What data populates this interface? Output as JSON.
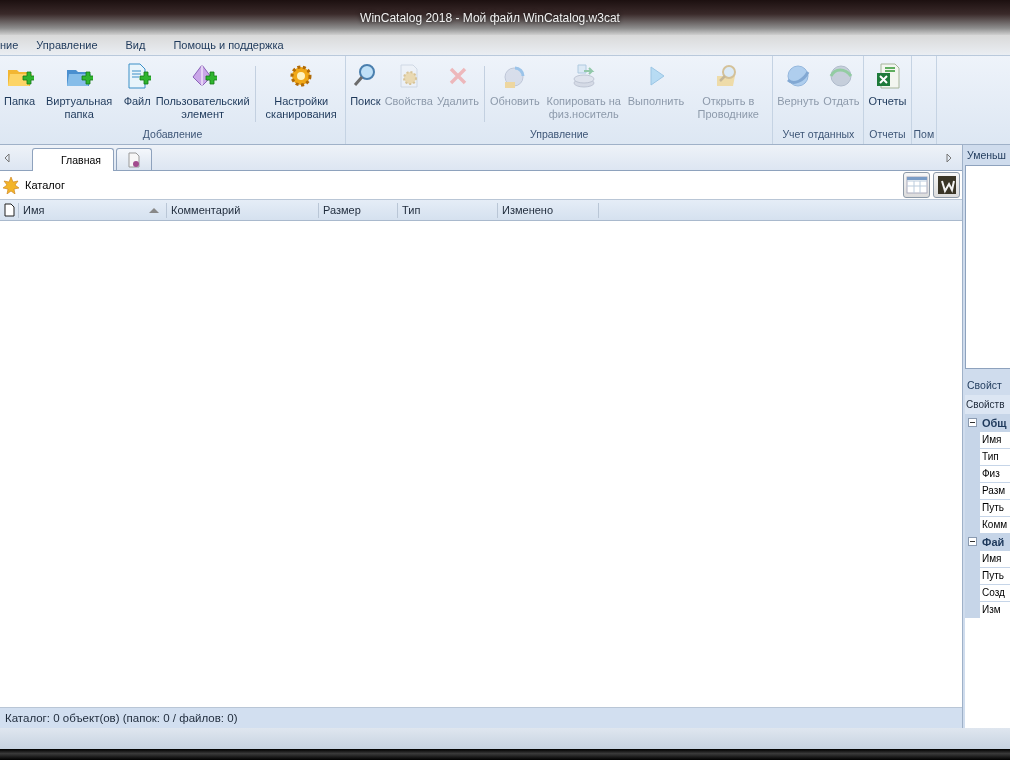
{
  "window": {
    "title": "WinCatalog 2018 - Мой файл WinCatalog.w3cat"
  },
  "menu": [
    "ние",
    "Управление",
    "Вид",
    "Помощь и поддержка"
  ],
  "ribbon": [
    {
      "label": "Добавление",
      "sections": [
        [
          {
            "label": "Папка",
            "disabled": false
          },
          {
            "label": "Виртуальная папка",
            "disabled": false
          },
          {
            "label": "Файл",
            "disabled": false
          },
          {
            "label": "Пользовательский элемент",
            "disabled": false
          }
        ],
        [
          {
            "label": "Настройки сканирования",
            "disabled": false
          }
        ]
      ]
    },
    {
      "label": "Управление",
      "sections": [
        [
          {
            "label": "Поиск",
            "disabled": false
          },
          {
            "label": "Свойства",
            "disabled": true
          },
          {
            "label": "Удалить",
            "disabled": true
          }
        ],
        [
          {
            "label": "Обновить",
            "disabled": true
          },
          {
            "label": "Копировать на физ.носитель",
            "disabled": true
          },
          {
            "label": "Выполнить",
            "disabled": true
          },
          {
            "label": "Открыть в Проводнике",
            "disabled": true
          }
        ]
      ]
    },
    {
      "label": "Учет отданных",
      "sections": [
        [
          {
            "label": "Вернуть",
            "disabled": true
          },
          {
            "label": "Отдать",
            "disabled": true
          }
        ]
      ]
    },
    {
      "label": "Отчеты",
      "sections": [
        [
          {
            "label": "Отчеты",
            "disabled": false
          }
        ]
      ]
    },
    {
      "label": "Пом"
    }
  ],
  "tabs": [
    {
      "label": "Главная",
      "selected": true
    },
    {
      "kind": "icon",
      "selected": false
    }
  ],
  "path": {
    "label": "Каталог"
  },
  "columns": [
    {
      "label": "Имя",
      "sorted": true
    },
    {
      "label": "Комментарий",
      "sorted": false
    },
    {
      "label": "Размер",
      "sorted": false
    },
    {
      "label": "Тип",
      "sorted": false
    },
    {
      "label": "Изменено",
      "sorted": false
    }
  ],
  "status_bar": "Каталог: 0 объект(ов) (папок: 0 / файлов: 0)",
  "preview_panel": {
    "title": "Уменьш"
  },
  "properties_panel": {
    "title": "Свойст",
    "subtitle": "Свойств",
    "groups": [
      {
        "label": "Общ",
        "expanded": true,
        "rows": [
          "Имя",
          "Тип",
          "Физ",
          "Разм",
          "Путь",
          "Комм"
        ]
      },
      {
        "label": "Фай",
        "expanded": true,
        "rows": [
          "Имя",
          "Путь",
          "Созд",
          "Изм"
        ]
      }
    ]
  }
}
